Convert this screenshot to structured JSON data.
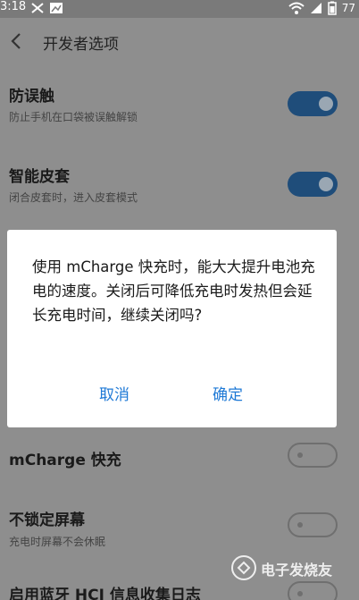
{
  "status_bar": {
    "time": "3:18",
    "battery": "77"
  },
  "header": {
    "title": "开发者选项"
  },
  "settings": [
    {
      "title": "防误触",
      "subtitle": "防止手机在口袋被误触解锁",
      "toggle": "on"
    },
    {
      "title": "智能皮套",
      "subtitle": "闭合皮套时，进入皮套模式",
      "toggle": "on"
    },
    {
      "title": "mCharge 快充",
      "subtitle": "",
      "toggle": "off"
    },
    {
      "title": "不锁定屏幕",
      "subtitle": "充电时屏幕不会休眠",
      "toggle": "off"
    },
    {
      "title": "启用蓝牙 HCI 信息收集日志",
      "subtitle": "",
      "toggle": "off"
    }
  ],
  "dialog": {
    "message": "使用 mCharge 快充时，能大大提升电池充电的速度。关闭后可降低充电时发热但会延长充电时间，继续关闭吗?",
    "cancel_label": "取消",
    "confirm_label": "确定"
  },
  "watermark": {
    "text": "电子发烧友"
  }
}
